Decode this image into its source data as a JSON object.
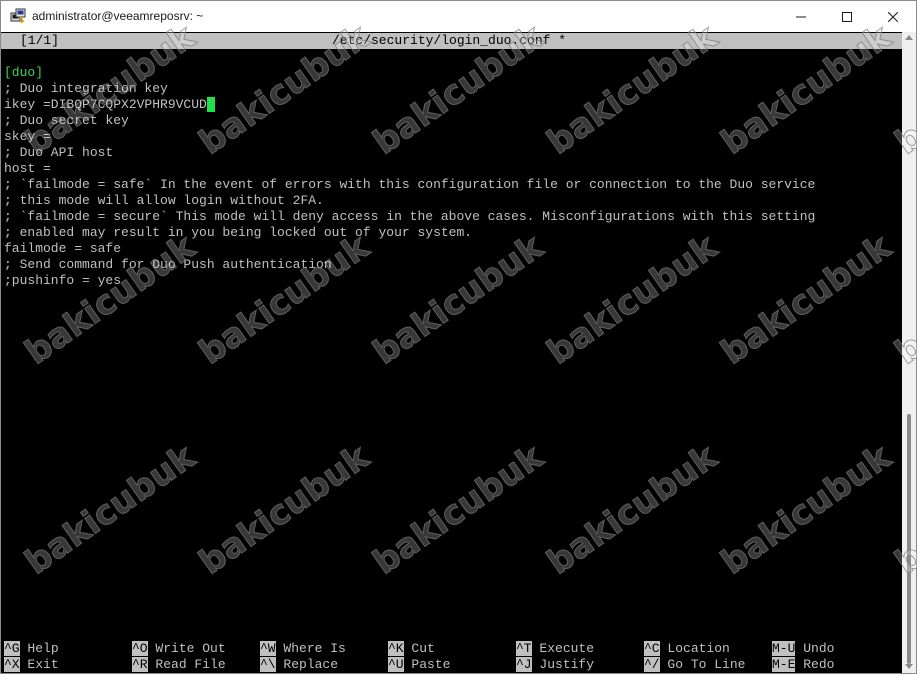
{
  "window": {
    "title": "administrator@veeamreposrv: ~"
  },
  "nano": {
    "status_left": "[1/1]",
    "status_file": "/etc/security/login_duo.conf *",
    "lines": [
      "; Duo integration key",
      "ikey =DIBQP7CQPX2VPHR9VCUD",
      "; Duo secret key",
      "skey =",
      "; Duo API host",
      "host =",
      "; `failmode = safe` In the event of errors with this configuration file or connection to the Duo service",
      "; this mode will allow login without 2FA.",
      "; `failmode = secure` This mode will deny access in the above cases. Misconfigurations with this setting",
      "; enabled may result in you being locked out of your system.",
      "failmode = safe",
      "; Send command for Duo Push authentication",
      ";pushinfo = yes"
    ],
    "section_header": "[duo]",
    "shortcuts": [
      {
        "key": "^G",
        "label": "Help"
      },
      {
        "key": "^X",
        "label": "Exit"
      },
      {
        "key": "^O",
        "label": "Write Out"
      },
      {
        "key": "^R",
        "label": "Read File"
      },
      {
        "key": "^W",
        "label": "Where Is"
      },
      {
        "key": "^\\",
        "label": "Replace"
      },
      {
        "key": "^K",
        "label": "Cut"
      },
      {
        "key": "^U",
        "label": "Paste"
      },
      {
        "key": "^T",
        "label": "Execute"
      },
      {
        "key": "^J",
        "label": "Justify"
      },
      {
        "key": "^C",
        "label": "Location"
      },
      {
        "key": "^/",
        "label": "Go To Line"
      },
      {
        "key": "M-U",
        "label": "Undo"
      },
      {
        "key": "M-E",
        "label": "Redo"
      }
    ]
  },
  "watermark": {
    "text": "bakicubuk"
  },
  "colors": {
    "terminal_bg": "#000000",
    "terminal_fg": "#c0c0c0",
    "section": "#39d353",
    "cursor": "#21e04a"
  },
  "icons": {
    "app": "putty-icon",
    "minimize": "minimize-icon",
    "maximize": "maximize-icon",
    "close": "close-icon"
  }
}
